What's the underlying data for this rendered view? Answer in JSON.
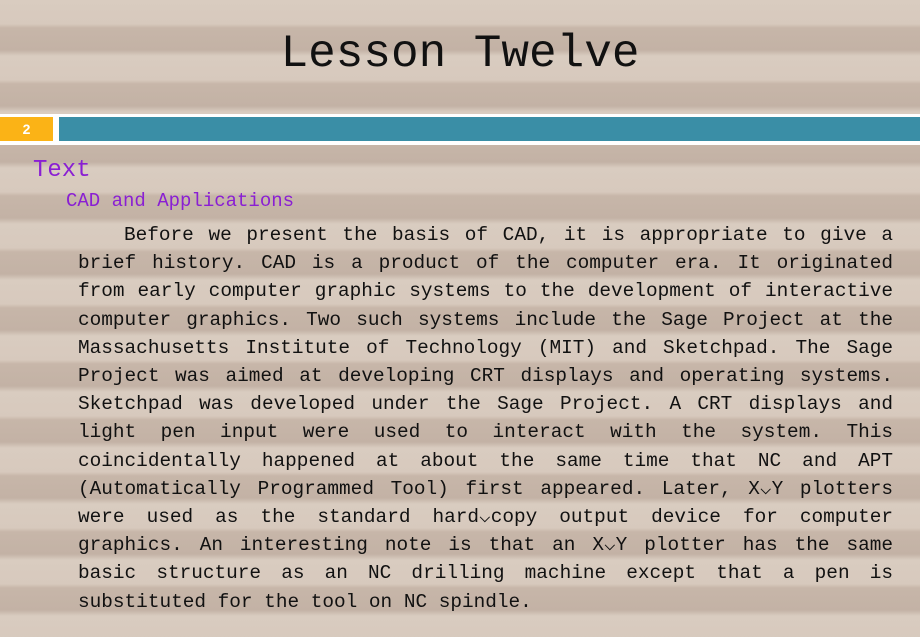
{
  "slide": {
    "title": "Lesson Twelve",
    "slide_number": "2",
    "colors": {
      "slide_number_bg": "#fbb316",
      "accent_bar": "#3a8ea6",
      "heading_text": "#8a1fd3",
      "body_text": "#111111"
    }
  },
  "content": {
    "section_heading": "Text",
    "sub_heading": "CAD and Applications",
    "paragraph": "Before we present the basis of CAD, it is appropriate to give a brief history. CAD is a product of the computer era. It originated from early computer graphic systems to the development of interactive computer graphics. Two such systems include the Sage Project at the Massachusetts Institute of Technology (MIT) and Sketchpad. The Sage Project was aimed at developing CRT displays and operating systems. Sketchpad was developed under the Sage Project. A CRT displays and light pen input were used to interact with the system. This coincidentally happened at about the same time that NC and APT (Automatically Programmed Tool) first appeared. Later, X⌵Y plotters were used as the standard hard⌵copy output device for computer graphics. An interesting note is that an X⌵Y plotter has the same basic structure as an NC drilling machine except that a pen is substituted for the tool on NC spindle."
  }
}
